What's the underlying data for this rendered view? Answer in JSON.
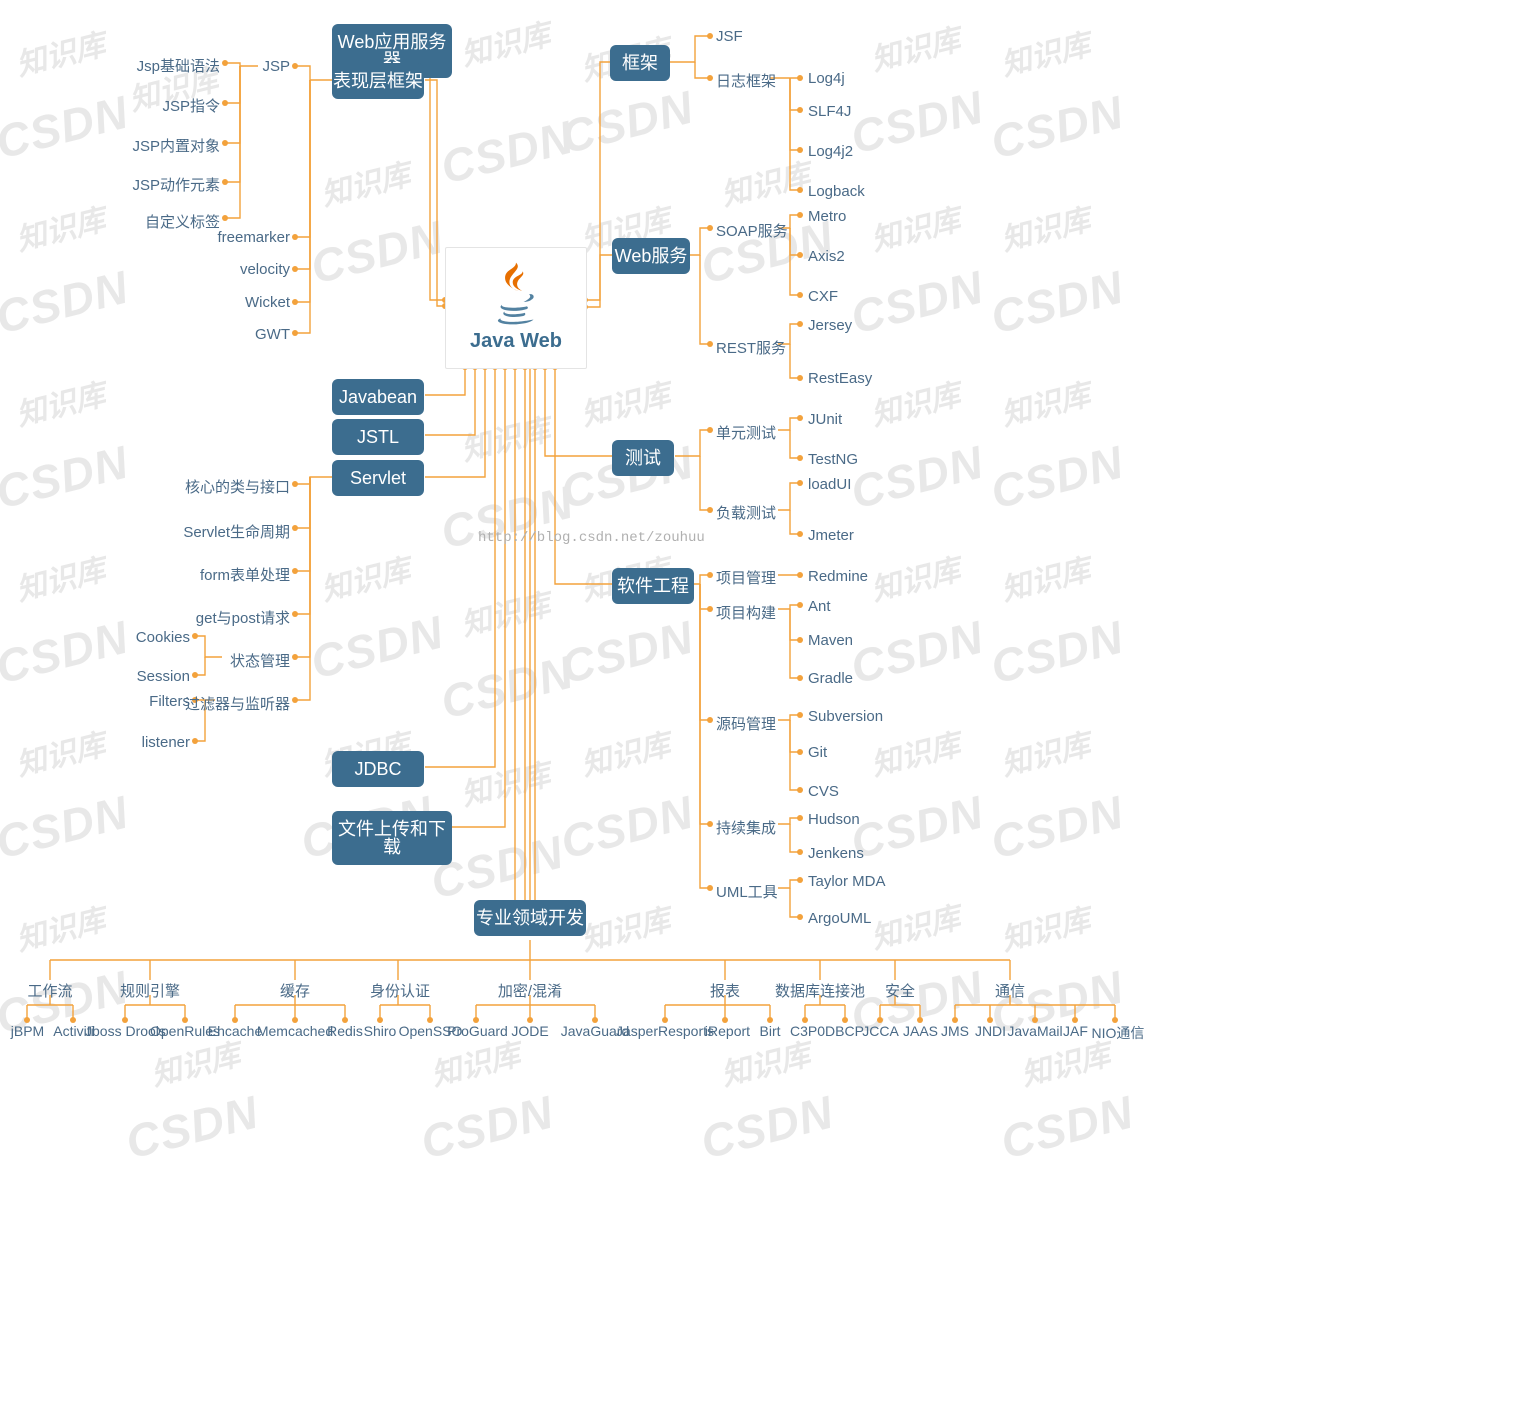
{
  "center": {
    "title": "Java Web"
  },
  "url_watermark": "http://blog.csdn.net/zouhuu",
  "wm": {
    "csdn": "CSDN",
    "zsk": "知识库"
  },
  "left_pills": {
    "webAppServer": "Web应用服务器",
    "viewFramework": "表现层框架",
    "javabean": "Javabean",
    "jstl": "JSTL",
    "servlet": "Servlet",
    "jdbc": "JDBC",
    "fileUpDown": "文件上传和下载",
    "domainDev": "专业领域开发"
  },
  "view_fw": {
    "jsp": "JSP",
    "jsp_children": {
      "basic": "Jsp基础语法",
      "direct": "JSP指令",
      "builtin": "JSP内置对象",
      "action": "JSP动作元素",
      "custom": "自定义标签"
    },
    "freemarker": "freemarker",
    "velocity": "velocity",
    "wicket": "Wicket",
    "gwt": "GWT"
  },
  "servlet_children": {
    "core": "核心的类与接口",
    "life": "Servlet生命周期",
    "form": "form表单处理",
    "getpost": "get与post请求",
    "state": "状态管理",
    "filter": "过滤器与监听器",
    "state_sub": {
      "cookies": "Cookies",
      "session": "Session",
      "filters": "Filters",
      "listener": "listener"
    }
  },
  "right_pills": {
    "framework": "框架",
    "webservice": "Web服务",
    "test": "测试",
    "se": "软件工程"
  },
  "framework": {
    "jsf": "JSF",
    "logfw": "日志框架",
    "log_children": {
      "log4j": "Log4j",
      "slf4j": "SLF4J",
      "log4j2": "Log4j2",
      "logback": "Logback"
    }
  },
  "webservice": {
    "soap": "SOAP服务",
    "soap_children": {
      "metro": "Metro",
      "axis2": "Axis2",
      "cxf": "CXF"
    },
    "rest": "REST服务",
    "rest_children": {
      "jersey": "Jersey",
      "resteasy": "RestEasy"
    }
  },
  "test": {
    "unit": "单元测试",
    "unit_children": {
      "junit": "JUnit",
      "testng": "TestNG"
    },
    "load": "负载测试",
    "load_children": {
      "loadui": "loadUI",
      "jmeter": "Jmeter"
    }
  },
  "se": {
    "pm": "项目管理",
    "pm_children": {
      "redmine": "Redmine"
    },
    "build": "项目构建",
    "build_children": {
      "ant": "Ant",
      "maven": "Maven",
      "gradle": "Gradle"
    },
    "scm": "源码管理",
    "scm_children": {
      "svn": "Subversion",
      "git": "Git",
      "cvs": "CVS"
    },
    "ci": "持续集成",
    "ci_children": {
      "hudson": "Hudson",
      "jenkens": "Jenkens"
    },
    "uml": "UML工具",
    "uml_children": {
      "taylor": "Taylor MDA",
      "argo": "ArgoUML"
    }
  },
  "domain": {
    "workflow": {
      "label": "工作流",
      "children": [
        "jBPM",
        "Activiti"
      ]
    },
    "rules": {
      "label": "规则引擎",
      "children": [
        "Jboss Drools",
        "OpenRules"
      ]
    },
    "cache": {
      "label": "缓存",
      "children": [
        "Ehcache",
        "Memcached",
        "Redis"
      ]
    },
    "auth": {
      "label": "身份认证",
      "children": [
        "Shiro",
        "OpenSSO"
      ]
    },
    "crypto": {
      "label": "加密/混淆",
      "children": [
        "ProGuard",
        "JODE",
        "JavaGuard"
      ]
    },
    "report": {
      "label": "报表",
      "children": [
        "JasperResports",
        "iReport",
        "Birt"
      ]
    },
    "dbpool": {
      "label": "数据库连接池",
      "children": [
        "C3P0",
        "DBCP"
      ]
    },
    "security": {
      "label": "安全",
      "children": [
        "JCCA",
        "JAAS"
      ]
    },
    "comm": {
      "label": "通信",
      "children": [
        "JMS",
        "JNDI",
        "JavaMail",
        "JAF",
        "NIO通信"
      ]
    }
  }
}
